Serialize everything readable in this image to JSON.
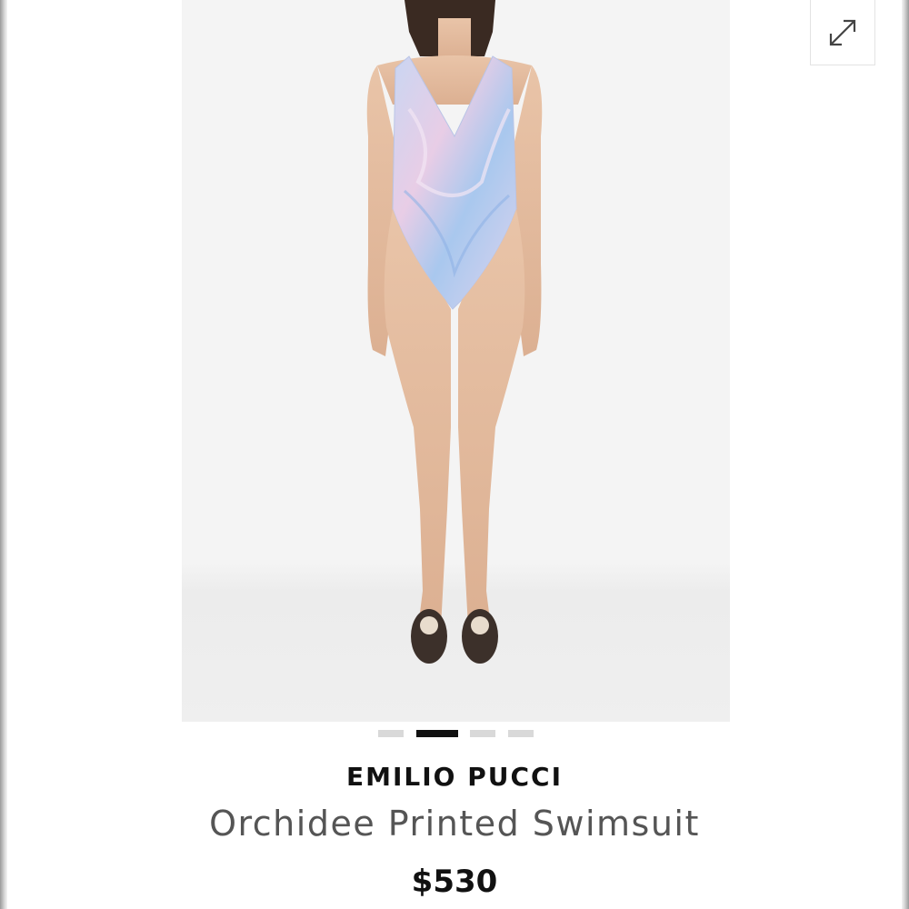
{
  "product": {
    "brand": "EMILIO PUCCI",
    "name": "Orchidee Printed Swimsuit",
    "price": "$530"
  },
  "gallery": {
    "image_alt": "Model wearing printed one-piece swimsuit",
    "expand_icon": "expand-arrows-icon",
    "slide_count": 4,
    "active_slide": 2
  },
  "colors": {
    "accent": "#111111",
    "dot_inactive": "#d9d9d9",
    "title_text": "#555555",
    "image_background": "#f4f4f4"
  }
}
